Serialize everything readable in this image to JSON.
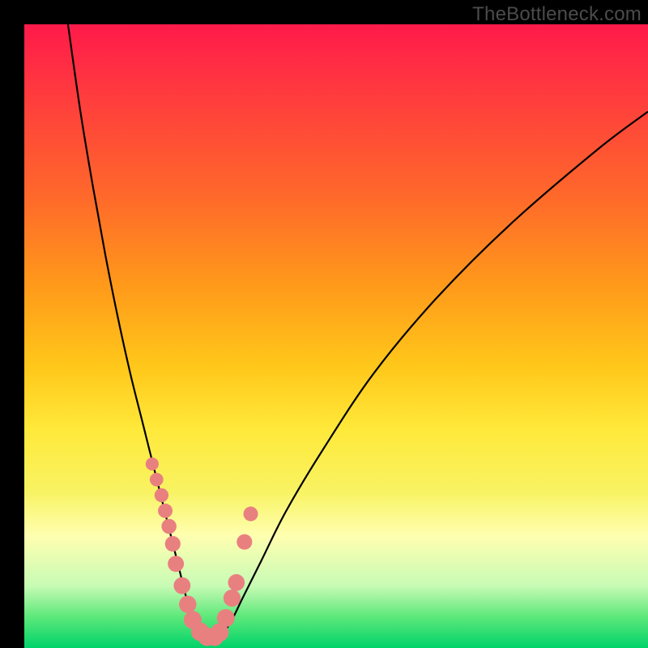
{
  "watermark": "TheBottleneck.com",
  "colors": {
    "curve": "#000000",
    "markers": "#e98080",
    "frame_bg": "#000000"
  },
  "chart_data": {
    "type": "line",
    "title": "",
    "xlabel": "",
    "ylabel": "",
    "xlim": [
      0,
      100
    ],
    "ylim": [
      0,
      100
    ],
    "note": "x and y are percent of plot-area width/height; y measured from top",
    "series": [
      {
        "name": "bottleneck-curve",
        "x": [
          7,
          9,
          11,
          13,
          15,
          17,
          19,
          21,
          22,
          23,
          24,
          25,
          26,
          27,
          28,
          29,
          31,
          33,
          35,
          38,
          42,
          48,
          56,
          66,
          78,
          92,
          100
        ],
        "y": [
          0,
          14,
          26,
          37,
          47,
          56,
          64,
          72,
          76,
          80,
          84,
          88,
          92,
          95,
          97,
          98.5,
          98.5,
          96,
          92,
          86,
          78,
          68,
          56,
          44,
          32,
          20,
          14
        ]
      }
    ],
    "markers": {
      "name": "sample-points",
      "x": [
        20.5,
        21.2,
        22.0,
        22.6,
        23.2,
        23.8,
        24.3,
        25.3,
        26.2,
        27.0,
        28.2,
        29.3,
        30.5,
        31.3,
        32.3,
        33.3,
        34.0,
        35.3,
        36.3
      ],
      "y": [
        70.5,
        73.0,
        75.5,
        78.0,
        80.5,
        83.3,
        86.5,
        90.0,
        93.0,
        95.5,
        97.4,
        98.2,
        98.2,
        97.5,
        95.2,
        92.0,
        89.5,
        83.0,
        78.5
      ]
    }
  }
}
